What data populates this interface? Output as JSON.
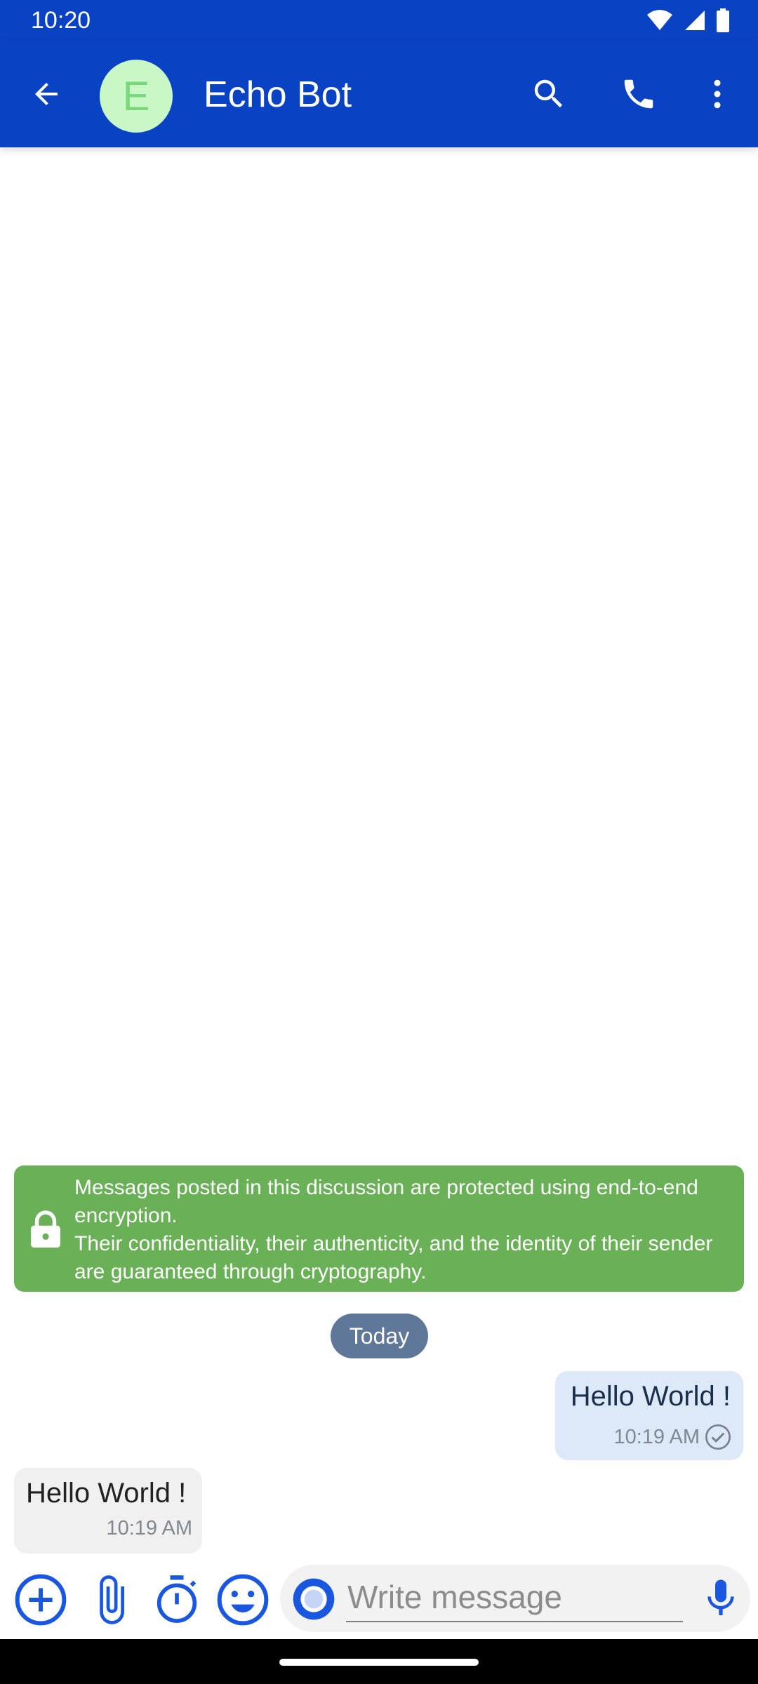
{
  "status_bar": {
    "time": "10:20"
  },
  "header": {
    "avatar_letter": "E",
    "title": "Echo Bot"
  },
  "notice": {
    "line1": "Messages posted in this discussion are protected using end-to-end encryption.",
    "line2": "Their confidentiality, their authenticity, and the identity of their sender are guaranteed through cryptography."
  },
  "date_separator": "Today",
  "messages": [
    {
      "direction": "outgoing",
      "text": "Hello World !",
      "time": "10:19 AM"
    },
    {
      "direction": "incoming",
      "text": "Hello World !",
      "time": "10:19 AM"
    }
  ],
  "composer": {
    "placeholder": "Write message"
  },
  "colors": {
    "primary": "#0a42c4",
    "avatar_bg": "#c9f7c5",
    "notice_bg": "#6ab057",
    "date_chip_bg": "#5f7799",
    "bubble_out_bg": "#dde9f8",
    "bubble_in_bg": "#f0f0f0",
    "icon_accent": "#1a57e0"
  },
  "icons": [
    "wifi-icon",
    "signal-icon",
    "battery-icon",
    "back-arrow-icon",
    "search-icon",
    "phone-icon",
    "more-vert-icon",
    "lock-icon",
    "check-circle-icon",
    "add-circle-icon",
    "paperclip-icon",
    "timer-icon",
    "emoji-icon",
    "bots-icon",
    "mic-icon"
  ]
}
